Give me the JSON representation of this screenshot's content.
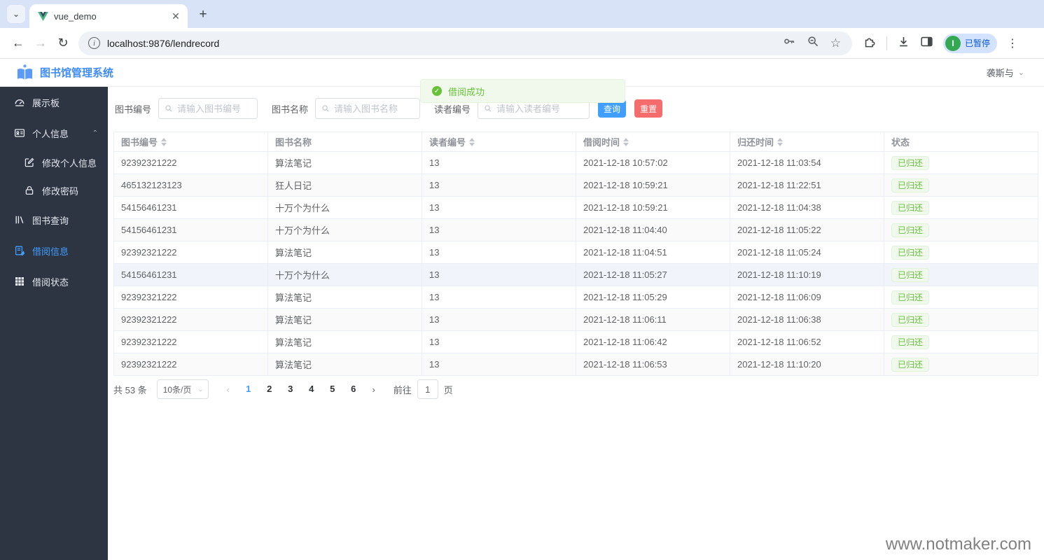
{
  "browser": {
    "tab_title": "vue_demo",
    "url": "localhost:9876/lendrecord",
    "profile": {
      "initial": "I",
      "label": "已暂停"
    }
  },
  "header": {
    "app_title": "图书馆管理系统",
    "username": "袭斯与"
  },
  "sidebar": {
    "items": [
      {
        "id": "dashboard",
        "label": "展示板"
      },
      {
        "id": "profile",
        "label": "个人信息"
      },
      {
        "id": "edit-profile",
        "label": "修改个人信息"
      },
      {
        "id": "change-password",
        "label": "修改密码"
      },
      {
        "id": "book-search",
        "label": "图书查询"
      },
      {
        "id": "lend-info",
        "label": "借阅信息"
      },
      {
        "id": "lend-status",
        "label": "借阅状态"
      }
    ],
    "active_item": "借阅信息"
  },
  "toast": {
    "message": "借阅成功"
  },
  "search_form": {
    "book_id": {
      "label": "图书编号",
      "placeholder": "请输入图书编号"
    },
    "book_name": {
      "label": "图书名称",
      "placeholder": "请输入图书名称"
    },
    "reader_id": {
      "label": "读者编号",
      "placeholder": "请输入读者编号"
    },
    "search_button": "查询",
    "reset_button": "重置"
  },
  "table": {
    "columns": [
      {
        "label": "图书编号",
        "sortable": true
      },
      {
        "label": "图书名称",
        "sortable": false
      },
      {
        "label": "读者编号",
        "sortable": true
      },
      {
        "label": "借阅时间",
        "sortable": true
      },
      {
        "label": "归还时间",
        "sortable": true
      },
      {
        "label": "状态",
        "sortable": false
      }
    ],
    "rows": [
      {
        "book_id": "92392321222",
        "book_name": "算法笔记",
        "reader_id": "13",
        "lend_time": "2021-12-18 10:57:02",
        "return_time": "2021-12-18 11:03:54",
        "status": "已归还"
      },
      {
        "book_id": "465132123123",
        "book_name": "狂人日记",
        "reader_id": "13",
        "lend_time": "2021-12-18 10:59:21",
        "return_time": "2021-12-18 11:22:51",
        "status": "已归还"
      },
      {
        "book_id": "54156461231",
        "book_name": "十万个为什么",
        "reader_id": "13",
        "lend_time": "2021-12-18 10:59:21",
        "return_time": "2021-12-18 11:04:38",
        "status": "已归还"
      },
      {
        "book_id": "54156461231",
        "book_name": "十万个为什么",
        "reader_id": "13",
        "lend_time": "2021-12-18 11:04:40",
        "return_time": "2021-12-18 11:05:22",
        "status": "已归还"
      },
      {
        "book_id": "92392321222",
        "book_name": "算法笔记",
        "reader_id": "13",
        "lend_time": "2021-12-18 11:04:51",
        "return_time": "2021-12-18 11:05:24",
        "status": "已归还"
      },
      {
        "book_id": "54156461231",
        "book_name": "十万个为什么",
        "reader_id": "13",
        "lend_time": "2021-12-18 11:05:27",
        "return_time": "2021-12-18 11:10:19",
        "status": "已归还"
      },
      {
        "book_id": "92392321222",
        "book_name": "算法笔记",
        "reader_id": "13",
        "lend_time": "2021-12-18 11:05:29",
        "return_time": "2021-12-18 11:06:09",
        "status": "已归还"
      },
      {
        "book_id": "92392321222",
        "book_name": "算法笔记",
        "reader_id": "13",
        "lend_time": "2021-12-18 11:06:11",
        "return_time": "2021-12-18 11:06:38",
        "status": "已归还"
      },
      {
        "book_id": "92392321222",
        "book_name": "算法笔记",
        "reader_id": "13",
        "lend_time": "2021-12-18 11:06:42",
        "return_time": "2021-12-18 11:06:52",
        "status": "已归还"
      },
      {
        "book_id": "92392321222",
        "book_name": "算法笔记",
        "reader_id": "13",
        "lend_time": "2021-12-18 11:06:53",
        "return_time": "2021-12-18 11:10:20",
        "status": "已归还"
      }
    ]
  },
  "pagination": {
    "total_label": "共 53 条",
    "page_size_label": "10条/页",
    "pages": [
      "1",
      "2",
      "3",
      "4",
      "5",
      "6"
    ],
    "active_page": "1",
    "goto_label": "前往",
    "goto_value": "1",
    "page_suffix": "页"
  },
  "watermark": "www.notmaker.com",
  "colors": {
    "accent": "#409eff",
    "danger": "#f56c6c",
    "success": "#67c23a",
    "success_bg": "#f0f9eb",
    "success_border": "#e1f3d8",
    "sidebar_bg": "#2d3442",
    "chrome_bg": "#d8e3f7"
  }
}
